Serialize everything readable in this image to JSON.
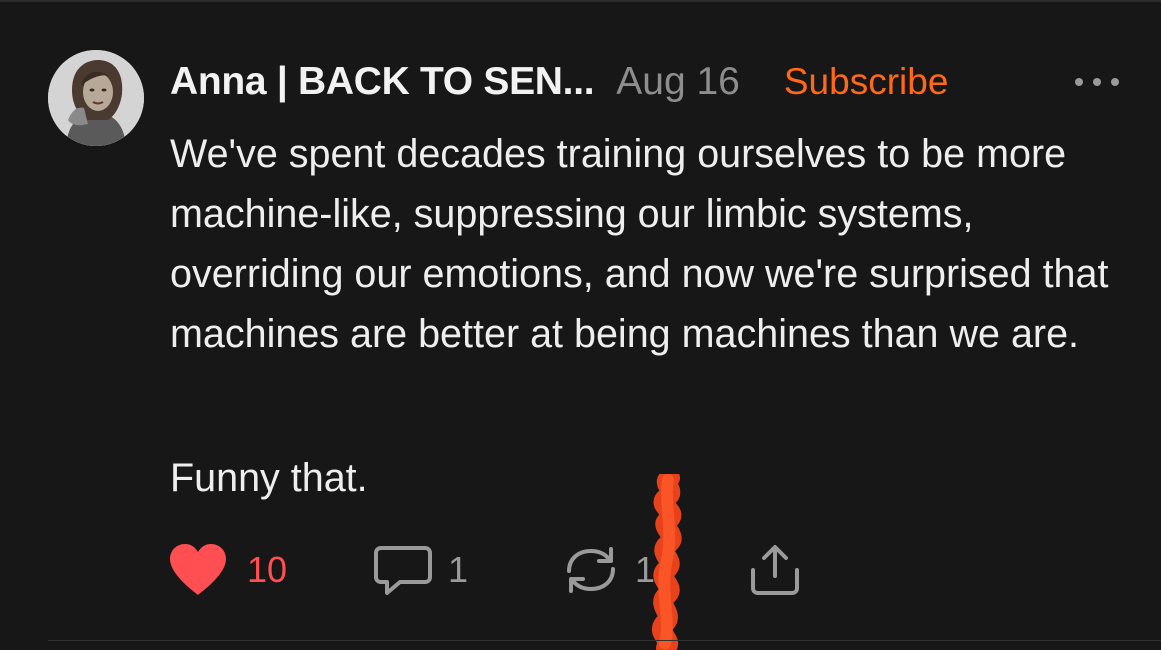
{
  "post": {
    "author": "Anna | BACK TO SEN...",
    "date": "Aug 16",
    "subscribe_label": "Subscribe",
    "more_icon": "more-horizontal-icon",
    "paragraphs": [
      "We've spent decades training ourselves to be more machine-like, suppressing our limbic systems, overriding our emotions, and now we're surprised that machines are better at being machines than we are.",
      "Funny that."
    ]
  },
  "actions": {
    "likes": "10",
    "comments": "1",
    "restacks": "1",
    "like_icon": "heart-icon",
    "comment_icon": "comment-icon",
    "restack_icon": "restack-icon",
    "share_icon": "share-icon"
  },
  "colors": {
    "background": "#171717",
    "accent": "#ff6719",
    "like": "#ff4f52",
    "muted": "#8d8d8d"
  }
}
